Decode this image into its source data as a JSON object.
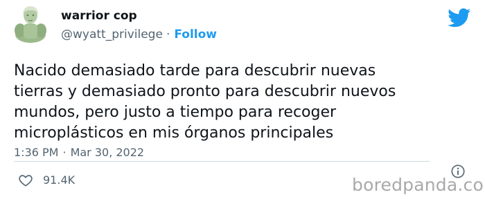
{
  "author": {
    "display_name": "warrior cop",
    "handle": "@wyatt_privilege",
    "separator": "·",
    "follow_label": "Follow",
    "avatar_icon": "muscular-statue-avatar"
  },
  "brand": {
    "icon": "twitter-bird-icon",
    "color": "#1d9bf0"
  },
  "tweet": {
    "text": "Nacido demasiado tarde para descubrir nuevas\ntierras y demasiado pronto para descubrir nuevos\nmundos, pero justo a tiempo para recoger\nmicroplásticos en mis órganos principales",
    "time": "1:36 PM",
    "separator": "·",
    "date": "Mar 30, 2022"
  },
  "engagement": {
    "like_icon": "heart-icon",
    "like_count": "91.4K",
    "info_icon": "info-icon"
  },
  "watermark": {
    "text": "boredpanda.com"
  }
}
